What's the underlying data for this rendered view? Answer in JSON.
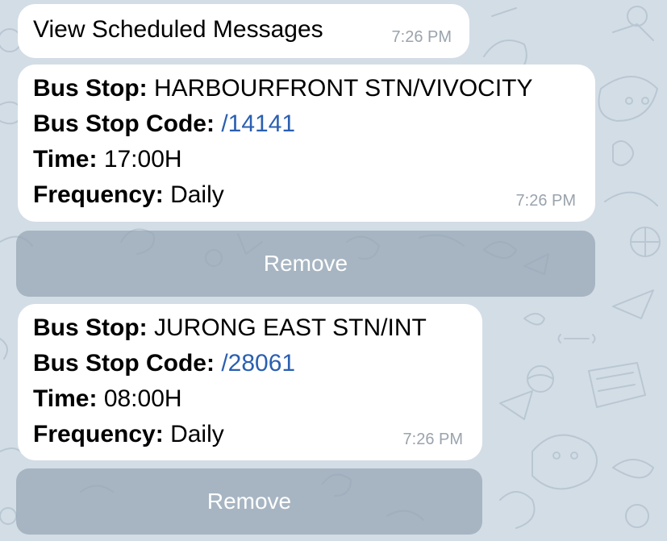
{
  "messages": {
    "view": {
      "text": "View Scheduled Messages",
      "time": "7:26 PM"
    },
    "stops": [
      {
        "bus_stop_label": "Bus Stop:",
        "bus_stop": "HARBOURFRONT STN/VIVOCITY",
        "code_label": "Bus Stop Code:",
        "code": "/14141",
        "time_label": "Time:",
        "time": "17:00H",
        "frequency_label": "Frequency:",
        "frequency": "Daily",
        "sent_time": "7:26 PM",
        "remove_label": "Remove"
      },
      {
        "bus_stop_label": "Bus Stop:",
        "bus_stop": "JURONG EAST STN/INT",
        "code_label": "Bus Stop Code:",
        "code": "/28061",
        "time_label": "Time:",
        "time": "08:00H",
        "frequency_label": "Frequency:",
        "frequency": "Daily",
        "sent_time": "7:26 PM",
        "remove_label": "Remove"
      }
    ]
  },
  "colors": {
    "chat_background": "#d3dde6",
    "bubble": "#ffffff",
    "link": "#2a5fb0",
    "timestamp": "#9aa3ac",
    "inline_button": "#96a5b4"
  }
}
